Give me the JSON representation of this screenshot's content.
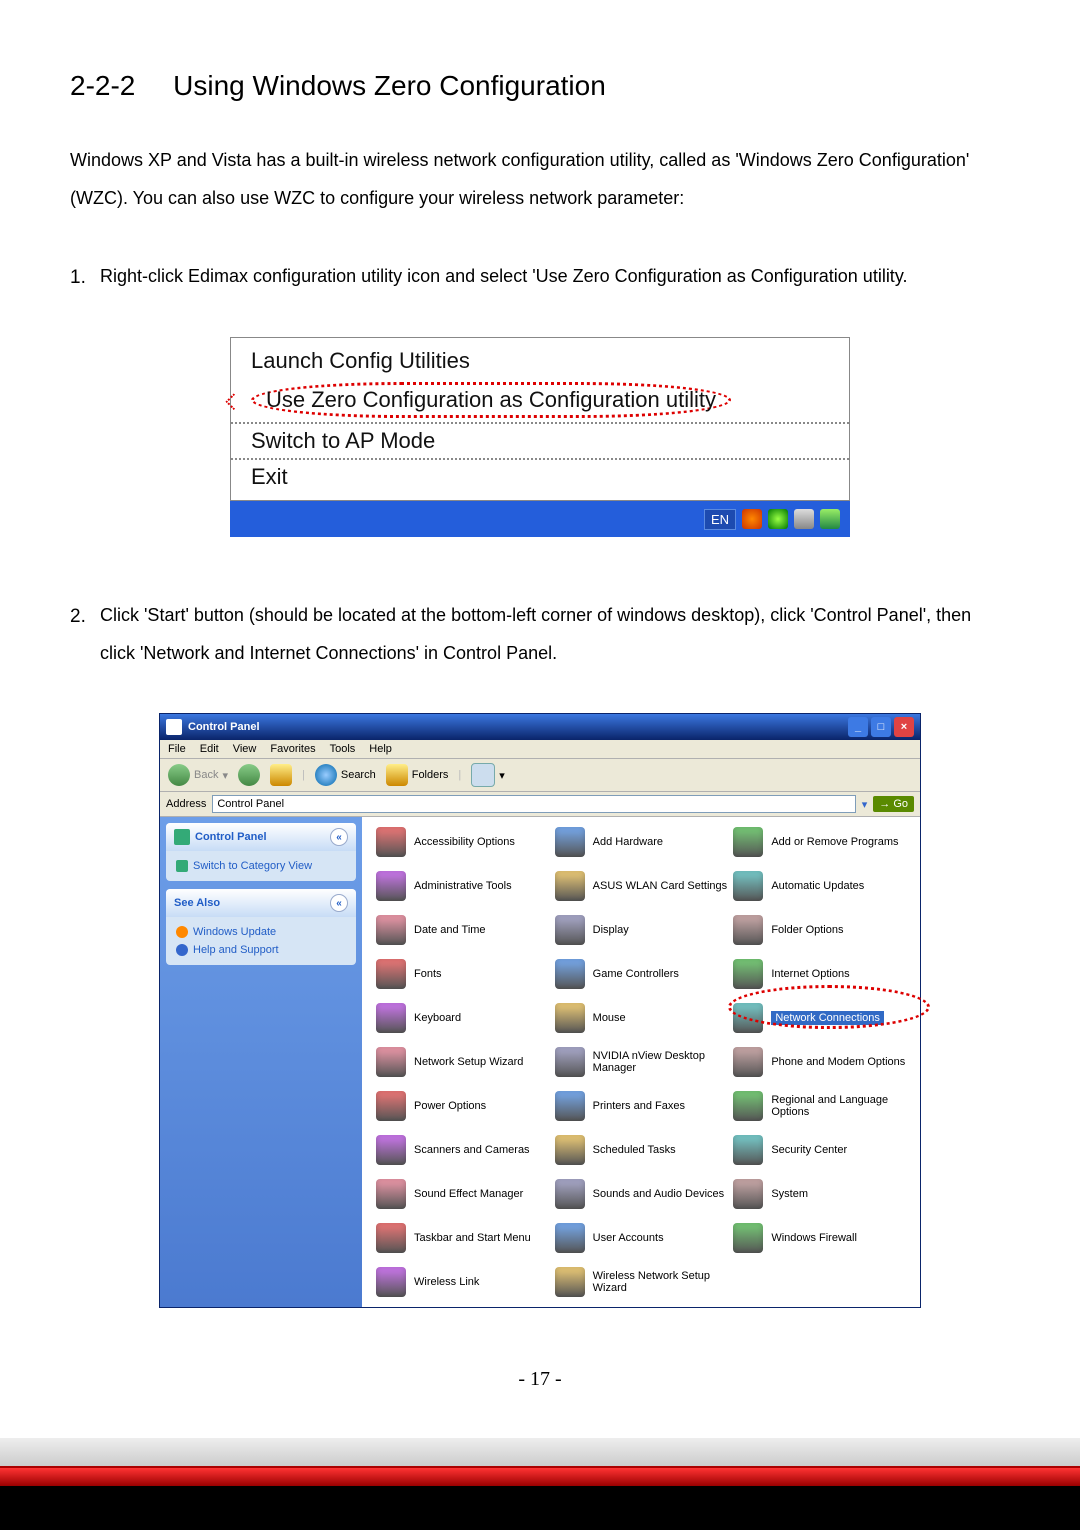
{
  "section": {
    "number": "2-2-2",
    "title": "Using Windows Zero Configuration"
  },
  "intro": "Windows XP and Vista has a built-in wireless network configuration utility, called as 'Windows Zero Configuration' (WZC). You can also use WZC to configure your wireless network parameter:",
  "steps": [
    {
      "num": "1.",
      "text": "Right-click Edimax configuration utility icon and select 'Use Zero Configuration as Configuration utility."
    },
    {
      "num": "2.",
      "text": "Click 'Start' button (should be located at the bottom-left corner of windows desktop), click 'Control Panel', then click 'Network and Internet Connections' in Control Panel."
    }
  ],
  "context_menu": {
    "items": [
      "Launch Config Utilities",
      "Use Zero Configuration as Configuration utility",
      "Switch to AP Mode",
      "Exit"
    ],
    "lang": "EN"
  },
  "cp_window": {
    "title": "Control Panel",
    "menubar": [
      "File",
      "Edit",
      "View",
      "Favorites",
      "Tools",
      "Help"
    ],
    "toolbar": {
      "back": "Back",
      "search": "Search",
      "folders": "Folders"
    },
    "address_label": "Address",
    "address_value": "Control Panel",
    "go": "Go",
    "side": {
      "panel1_title": "Control Panel",
      "panel1_link": "Switch to Category View",
      "panel2_title": "See Also",
      "panel2_links": [
        "Windows Update",
        "Help and Support"
      ]
    },
    "items": [
      "Accessibility Options",
      "Add Hardware",
      "Add or Remove Programs",
      "Administrative Tools",
      "ASUS WLAN Card Settings",
      "Automatic Updates",
      "Date and Time",
      "Display",
      "Folder Options",
      "Fonts",
      "Game Controllers",
      "Internet Options",
      "Keyboard",
      "Mouse",
      "Network Connections",
      "Network Setup Wizard",
      "NVIDIA nView Desktop Manager",
      "Phone and Modem Options",
      "Power Options",
      "Printers and Faxes",
      "Regional and Language Options",
      "Scanners and Cameras",
      "Scheduled Tasks",
      "Security Center",
      "Sound Effect Manager",
      "Sounds and Audio Devices",
      "System",
      "Taskbar and Start Menu",
      "User Accounts",
      "Windows Firewall",
      "Wireless Link",
      "Wireless Network Setup Wizard"
    ],
    "highlight_index": 14
  },
  "page_number": "- 17 -"
}
